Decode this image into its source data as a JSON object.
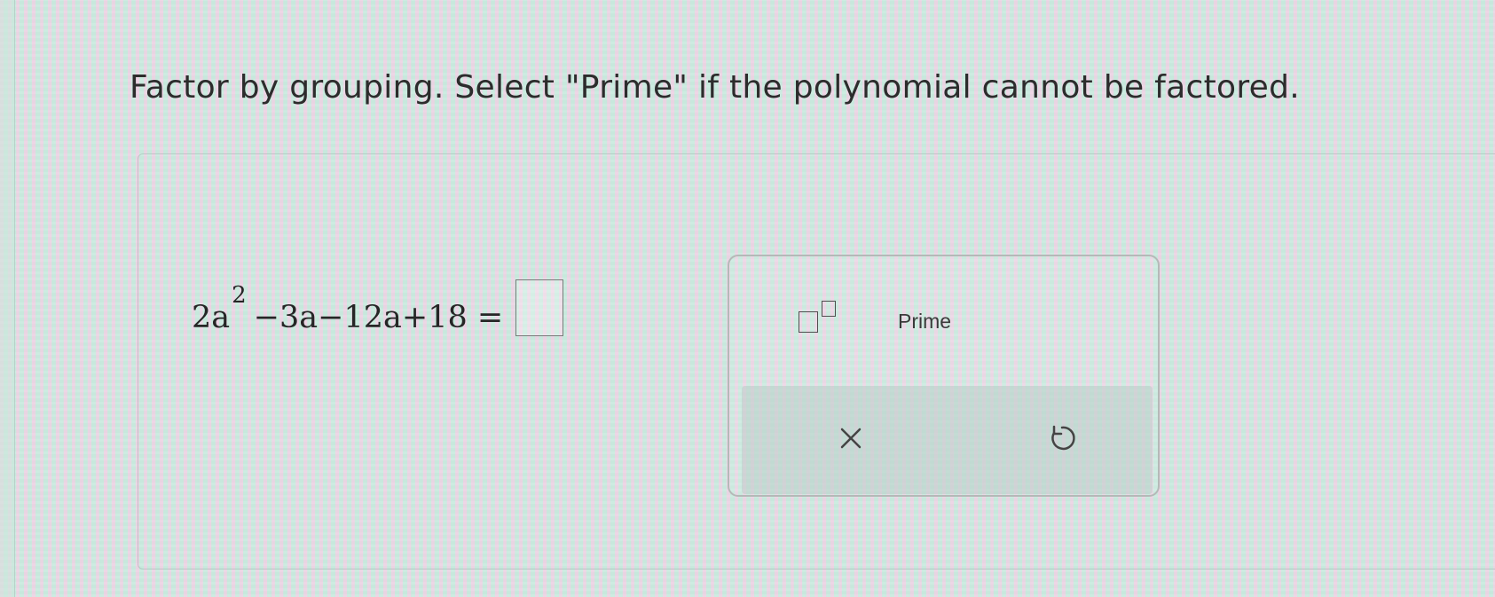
{
  "question": {
    "instruction": "Factor by grouping. Select \"Prime\" if the polynomial cannot be factored."
  },
  "equation": {
    "term1_coef": "2a",
    "term1_exp": "2",
    "rest": "−3a−12a+18 =",
    "answer_value": ""
  },
  "toolbar": {
    "exponent_icon": "exponent-template-icon",
    "prime_label": "Prime",
    "clear_icon": "close-icon",
    "undo_icon": "undo-icon"
  },
  "colors": {
    "text": "#2c2c2c",
    "panel_border": "#b5b9b8",
    "action_bar": "#b9cdc8"
  }
}
